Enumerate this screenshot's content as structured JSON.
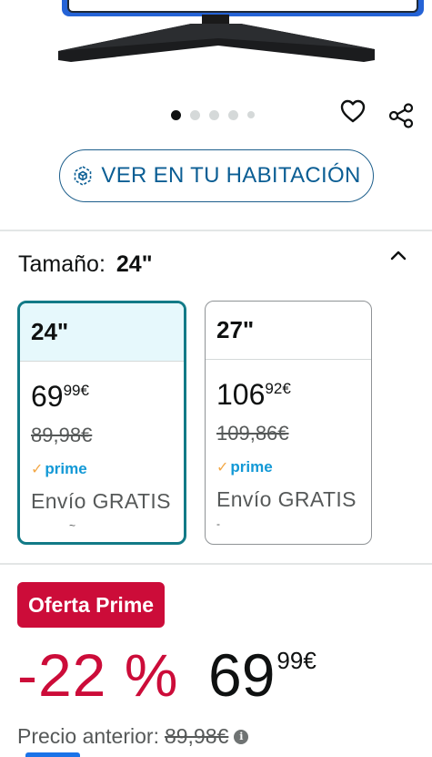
{
  "gallery": {
    "dot_count": 5,
    "active_dot": 0
  },
  "actions": {
    "wishlist_icon": "heart-icon",
    "share_icon": "share-icon"
  },
  "ar": {
    "label": "VER EN TU HABITACIÓN",
    "icon": "cube-3d-icon"
  },
  "size": {
    "label": "Tamaño:",
    "selected": "24\"",
    "collapse_icon": "chevron-up-icon"
  },
  "options": [
    {
      "size": "24\"",
      "price_whole": "69",
      "price_fraction": "99",
      "currency": "€",
      "old_price": "89,98€",
      "prime": "prime",
      "shipping": "Envío GRATIS",
      "selected": true
    },
    {
      "size": "27\"",
      "price_whole": "106",
      "price_fraction": "92",
      "currency": "€",
      "old_price": "109,86€",
      "prime": "prime",
      "shipping": "Envío GRATIS",
      "selected": false
    }
  ],
  "deal": {
    "badge": "Oferta Prime",
    "discount": "-22 %",
    "price_whole": "69",
    "price_fraction": "99",
    "currency": "€",
    "previous_label": "Precio anterior:",
    "previous_price": "89,98€"
  },
  "colors": {
    "accent": "#127a87",
    "deal_red": "#cc0c39",
    "link_blue": "#0b5e94",
    "prime_blue": "#1399d6"
  }
}
